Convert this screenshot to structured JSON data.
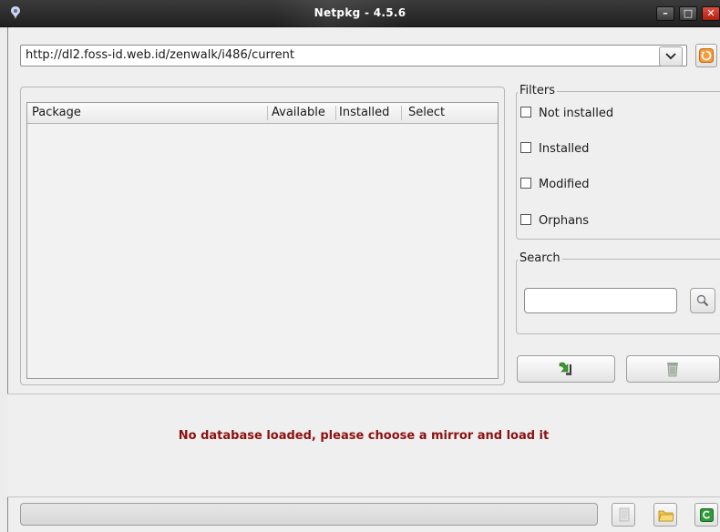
{
  "window": {
    "title": "Netpkg - 4.5.6",
    "minimize_label": "–",
    "maximize_label": "□",
    "close_label": "✕"
  },
  "mirror": {
    "url": "http://dl2.foss-id.web.id/zenwalk/i486/current"
  },
  "package_table": {
    "columns": [
      "Package",
      "Available",
      "Installed",
      "Select"
    ],
    "rows": []
  },
  "filters": {
    "legend": "Filters",
    "options": [
      {
        "label": "Not installed",
        "checked": false
      },
      {
        "label": "Installed",
        "checked": false
      },
      {
        "label": "Modified",
        "checked": false
      },
      {
        "label": "Orphans",
        "checked": false
      }
    ]
  },
  "search": {
    "legend": "Search",
    "value": ""
  },
  "status": {
    "message": "No database loaded, please choose a mirror and load it",
    "message_color": "#8b1010"
  },
  "icons": {
    "reload": "reload-icon",
    "dropdown": "chevron-down-icon",
    "search": "magnifier-icon",
    "install": "install-icon",
    "remove": "trash-icon",
    "log": "document-icon",
    "open": "folder-icon",
    "apply": "apply-icon"
  }
}
